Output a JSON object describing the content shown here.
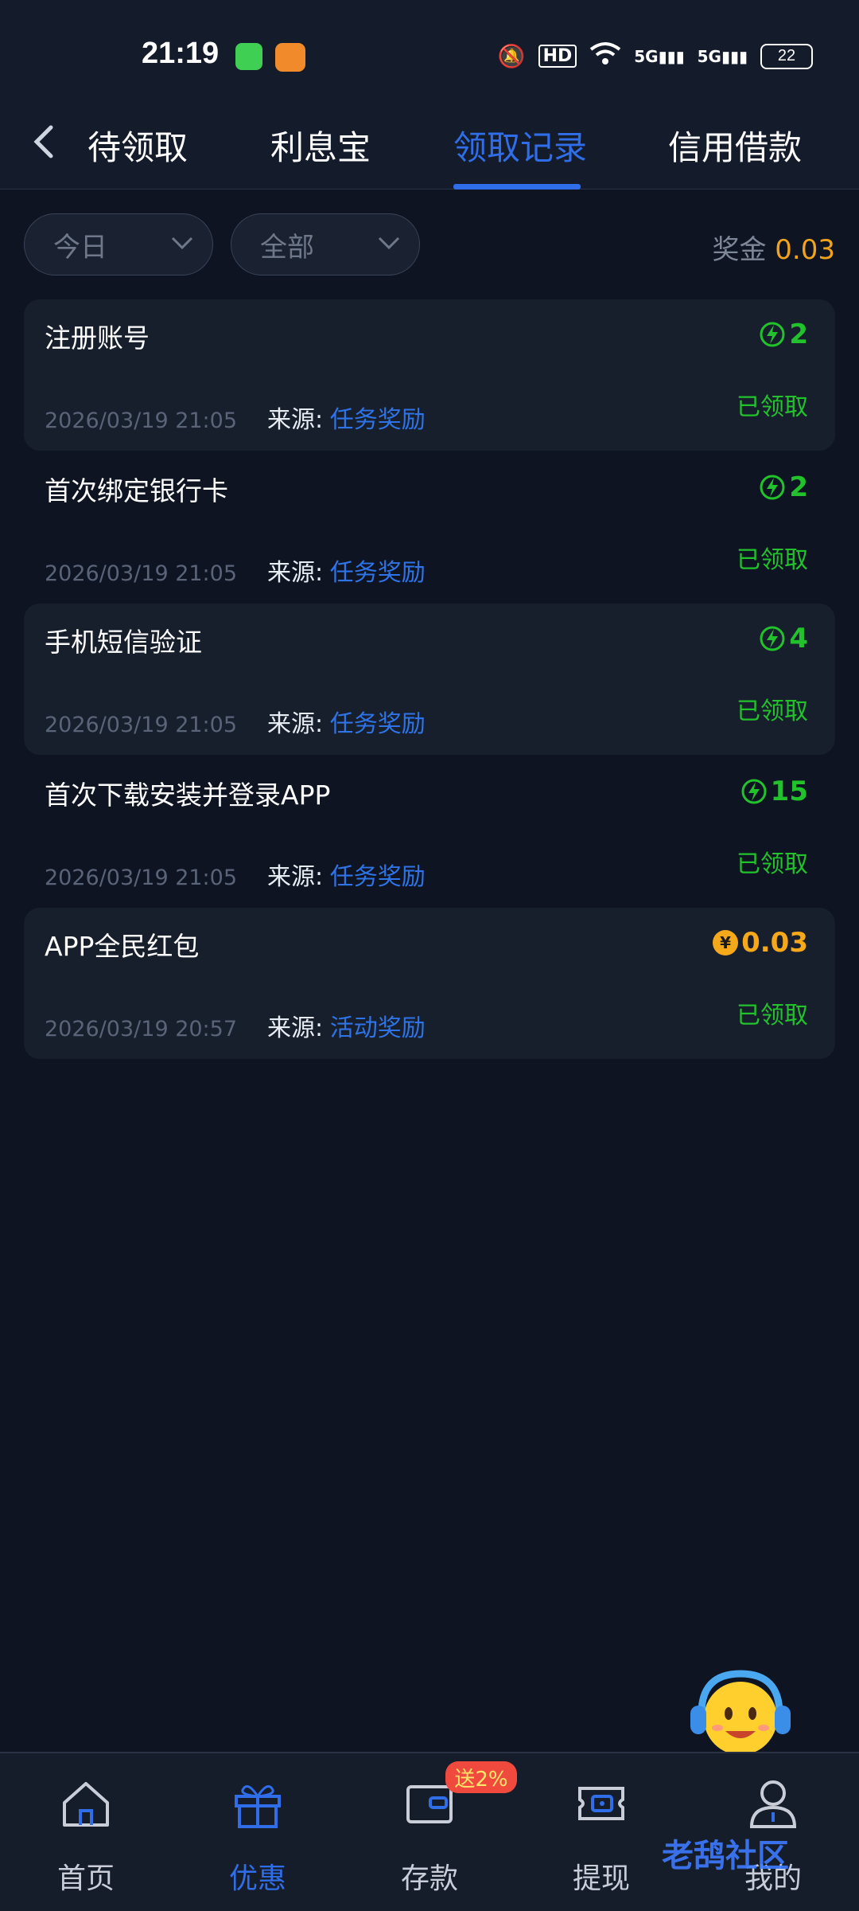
{
  "status_bar": {
    "time": "21:19",
    "battery": "22",
    "hd": "HD",
    "net1": "5G",
    "net2": "5G"
  },
  "tabs": [
    {
      "label": "待领取"
    },
    {
      "label": "利息宝"
    },
    {
      "label": "领取记录"
    },
    {
      "label": "信用借款"
    }
  ],
  "filters": {
    "date": "今日",
    "type": "全部"
  },
  "bonus": {
    "label": "奖金",
    "value": "0.03"
  },
  "records": [
    {
      "title": "注册账号",
      "datetime": "2026/03/19 21:05",
      "source_label": "来源:",
      "source": "任务奖励",
      "amount": "2",
      "status": "已领取"
    },
    {
      "title": "首次绑定银行卡",
      "datetime": "2026/03/19 21:05",
      "source_label": "来源:",
      "source": "任务奖励",
      "amount": "2",
      "status": "已领取"
    },
    {
      "title": "手机短信验证",
      "datetime": "2026/03/19 21:05",
      "source_label": "来源:",
      "source": "任务奖励",
      "amount": "4",
      "status": "已领取"
    },
    {
      "title": "首次下载安装并登录APP",
      "datetime": "2026/03/19 21:05",
      "source_label": "来源:",
      "source": "任务奖励",
      "amount": "15",
      "status": "已领取"
    },
    {
      "title": "APP全民红包",
      "datetime": "2026/03/19 20:57",
      "source_label": "来源:",
      "source": "活动奖励",
      "amount": "0.03",
      "status": "已领取",
      "coin": "¥"
    }
  ],
  "bottom_nav": [
    {
      "label": "首页"
    },
    {
      "label": "优惠"
    },
    {
      "label": "存款",
      "badge": "送2%"
    },
    {
      "label": "提现"
    },
    {
      "label": "我的"
    }
  ],
  "watermark": "老鸹社区",
  "colors": {
    "accent": "#2f6ee8",
    "green": "#22c22c",
    "gold": "#f5a81a",
    "background": "#0e1422"
  }
}
